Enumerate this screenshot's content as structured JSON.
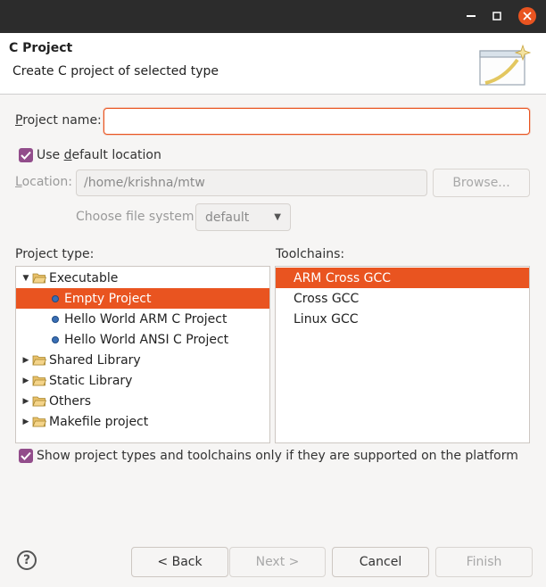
{
  "header": {
    "title": "C Project",
    "subtitle": "Create C project of selected type"
  },
  "project_name": {
    "label_pre": "",
    "label_mn": "P",
    "label_post": "roject name:",
    "value": ""
  },
  "use_default_location": {
    "label_pre": "Use ",
    "label_mn": "d",
    "label_post": "efault location",
    "checked": true
  },
  "location": {
    "label_pre": "",
    "label_mn": "L",
    "label_post": "ocation:",
    "value": "/home/krishna/mtw",
    "browse_label": "Browse..."
  },
  "file_system": {
    "label": "Choose file system:",
    "value": "default"
  },
  "project_type": {
    "label": "Project type:",
    "items": [
      {
        "label": "Executable",
        "kind": "folder",
        "expanded": true
      },
      {
        "label": "Empty Project",
        "kind": "leaf",
        "selected": true
      },
      {
        "label": "Hello World ARM C Project",
        "kind": "leaf"
      },
      {
        "label": "Hello World ANSI C Project",
        "kind": "leaf"
      },
      {
        "label": "Shared Library",
        "kind": "folder"
      },
      {
        "label": "Static Library",
        "kind": "folder"
      },
      {
        "label": "Others",
        "kind": "folder"
      },
      {
        "label": "Makefile project",
        "kind": "folder"
      }
    ]
  },
  "toolchains": {
    "label": "Toolchains:",
    "items": [
      {
        "label": "ARM Cross GCC",
        "selected": true
      },
      {
        "label": "Cross GCC"
      },
      {
        "label": "Linux GCC"
      }
    ]
  },
  "show_supported": {
    "label": "Show project types and toolchains only if they are supported on the platform",
    "checked": true
  },
  "footer": {
    "back": "< Back",
    "next": "Next >",
    "cancel": "Cancel",
    "finish": "Finish"
  },
  "colors": {
    "accent": "#e95420",
    "checkbox": "#924d8b",
    "titlebar": "#2c2c2c"
  }
}
